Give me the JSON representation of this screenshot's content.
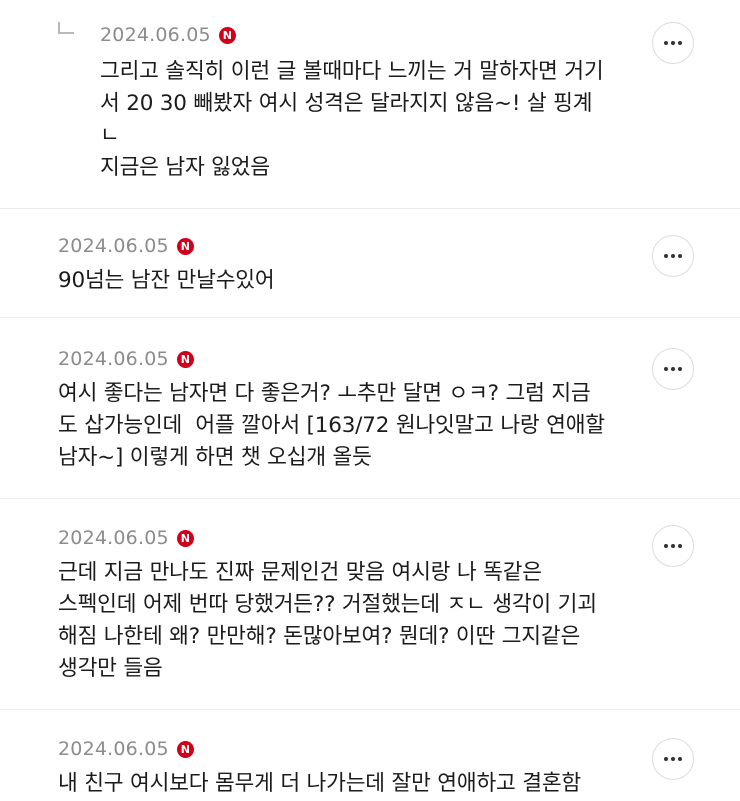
{
  "comments": [
    {
      "date": "2024.06.05",
      "badge": "N",
      "text": "그리고 솔직히 이런 글 볼때마다 느끼는 거 말하자면 거기\n서 20 30 빼봤자 여시 성격은 달라지지 않음~! 살 핑계\nㄴ\n지금은 남자 잃었음",
      "is_reply": true
    },
    {
      "date": "2024.06.05",
      "badge": "N",
      "text": "90넘는 남잔 만날수있어",
      "is_reply": false
    },
    {
      "date": "2024.06.05",
      "badge": "N",
      "text": "여시 좋다는 남자면 다 좋은거? ㅗ추만 달면 ㅇㅋ? 그럼 지금\n도 삽가능인데  어플 깔아서 [163/72 원나잇말고 나랑 연애할\n남자~] 이렇게 하면 챗 오십개 올듯",
      "is_reply": false
    },
    {
      "date": "2024.06.05",
      "badge": "N",
      "text": "근데 지금 만나도 진짜 문제인건 맞음 여시랑 나 똑같은\n스펙인데 어제 번따 당했거든?? 거절했는데 ㅈㄴ 생각이 기괴\n해짐 나한테 왜? 만만해? 돈많아보여? 뭔데? 이딴 그지같은\n생각만 들음",
      "is_reply": false
    },
    {
      "date": "2024.06.05",
      "badge": "N",
      "text": "내 친구 여시보다 몸무게 더 나가는데 잘만 연애하고 결혼함",
      "is_reply": false
    }
  ]
}
